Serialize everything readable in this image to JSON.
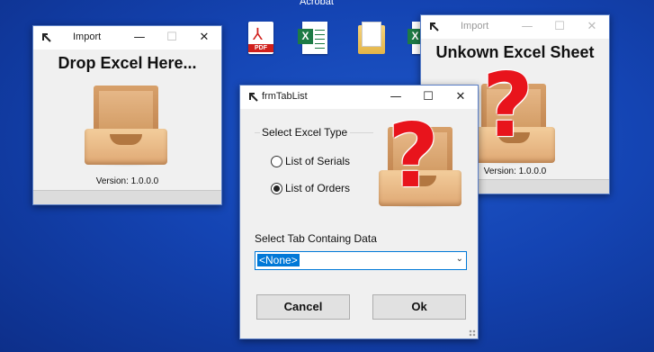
{
  "desktop": {
    "top_label": "Acrobat",
    "icons": [
      {
        "name": "pdf-file-icon",
        "label": "PDF"
      },
      {
        "name": "excel-file-icon",
        "label": "X"
      },
      {
        "name": "folder-icon",
        "label": ""
      },
      {
        "name": "excel-file-icon-2",
        "label": "X"
      }
    ]
  },
  "window_left": {
    "title": "Import",
    "heading": "Drop Excel Here...",
    "version": "Version: 1.0.0.0",
    "minimize": "—",
    "maximize": "☐",
    "close": "✕"
  },
  "window_right": {
    "title": "Import",
    "heading": "Unkown Excel Sheet",
    "version": "Version: 1.0.0.0",
    "question": "?",
    "minimize": "—",
    "maximize": "☐",
    "close": "✕"
  },
  "dialog": {
    "title": "frmTabList",
    "group_label": "Select Excel Type",
    "options": [
      {
        "label": "List of Serials",
        "checked": false
      },
      {
        "label": "List of Orders",
        "checked": true
      }
    ],
    "question": "?",
    "tab_label": "Select Tab Containg Data",
    "tab_value": "<None>",
    "cancel": "Cancel",
    "ok": "Ok",
    "minimize": "—",
    "maximize": "☐",
    "close": "✕"
  },
  "colors": {
    "desktop": "#1444b3",
    "accent": "#0078d7",
    "question": "#e8141c"
  }
}
